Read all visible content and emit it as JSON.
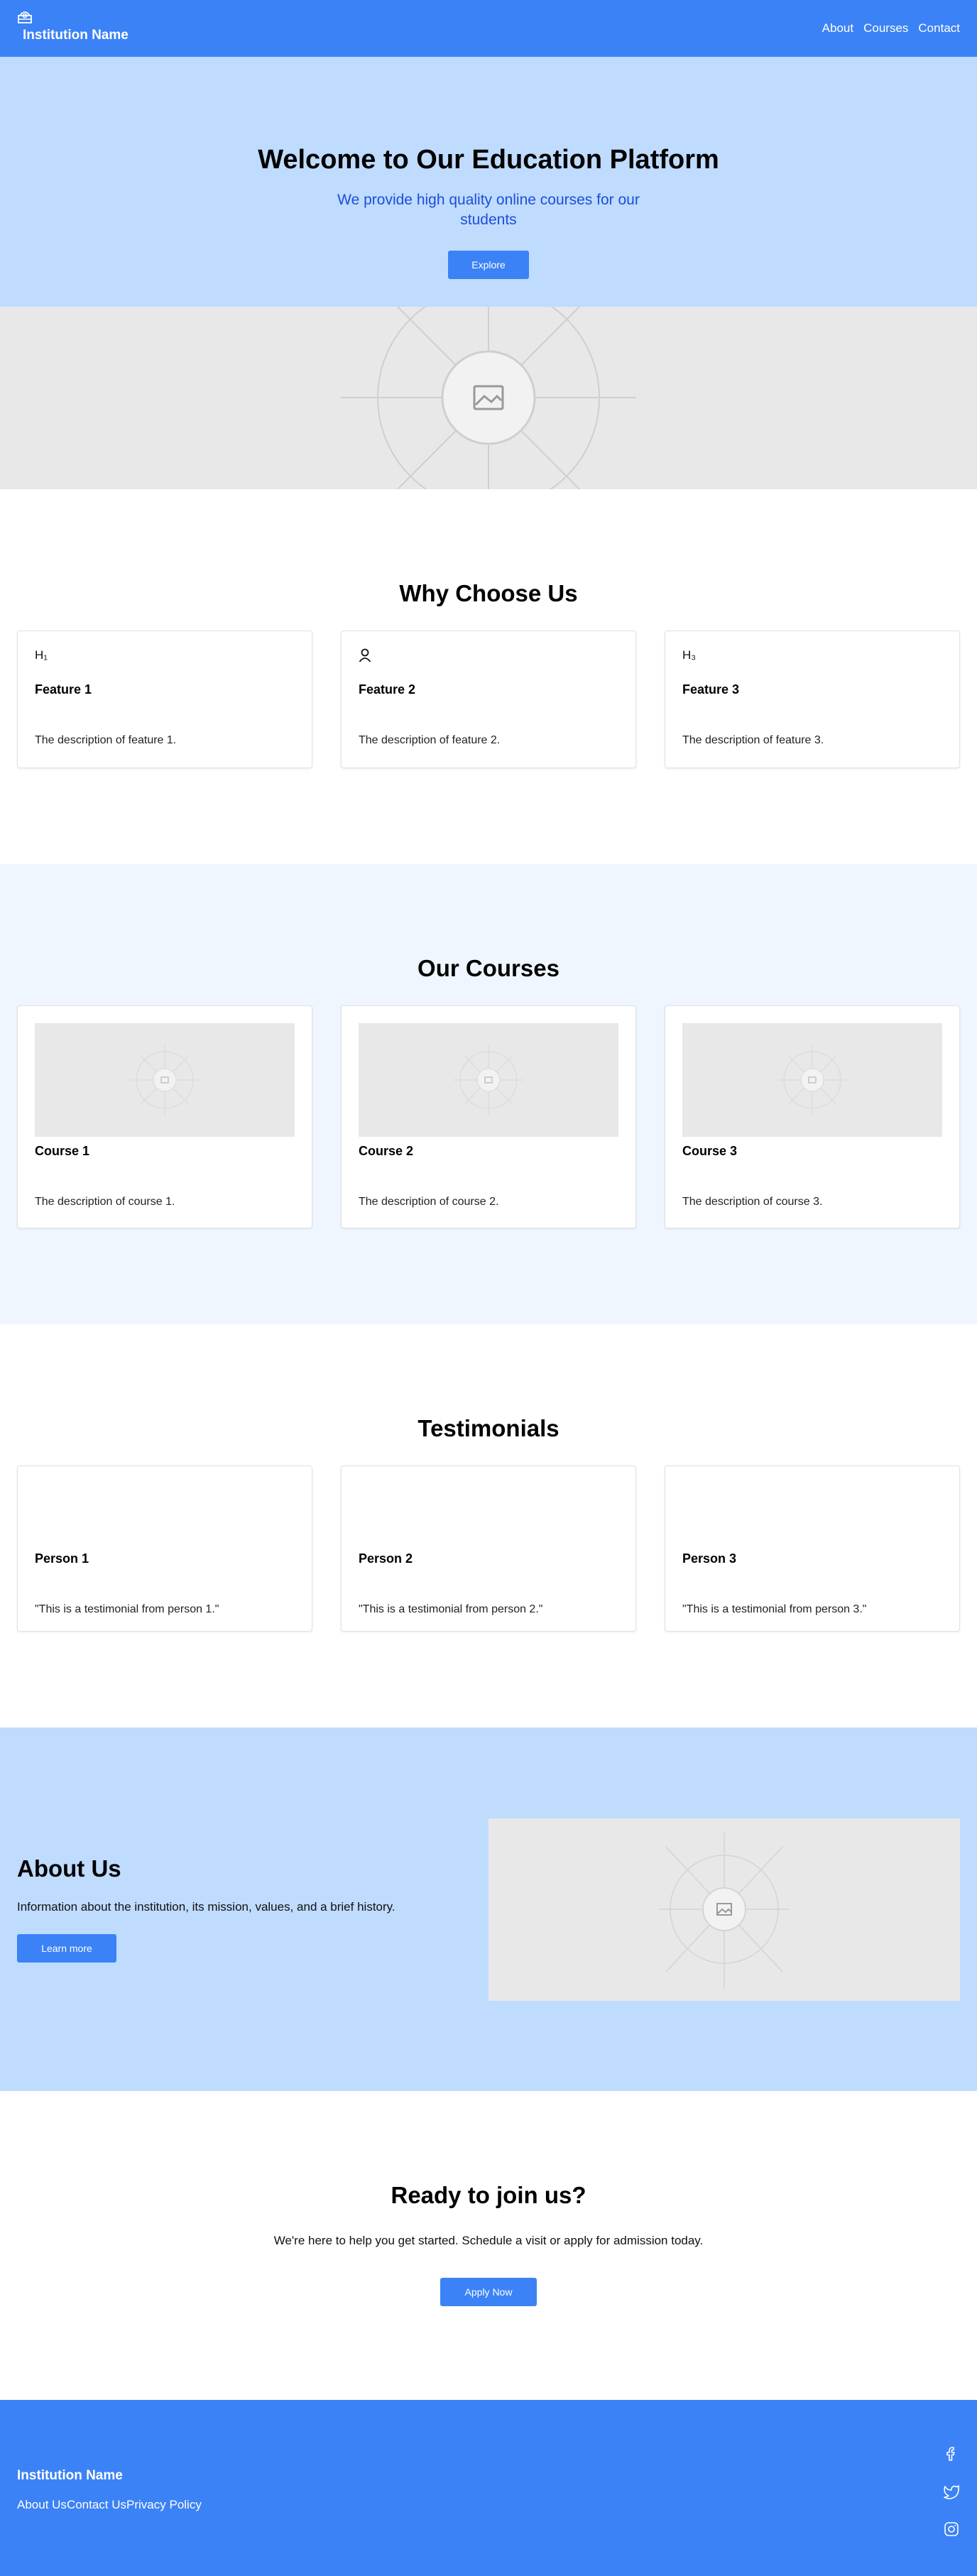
{
  "header": {
    "brand_name": "Institution Name",
    "nav": [
      "About",
      "Courses",
      "Contact"
    ]
  },
  "hero": {
    "title": "Welcome to Our Education Platform",
    "subtitle": "We provide high quality online courses for our students",
    "button_label": "Explore"
  },
  "features": {
    "title": "Why Choose Us",
    "items": [
      {
        "icon_label": "H₁",
        "icon": "heading-1-icon",
        "title": "Feature 1",
        "description": "The description of feature 1."
      },
      {
        "icon_label": "",
        "icon": "user-icon",
        "title": "Feature 2",
        "description": "The description of feature 2."
      },
      {
        "icon_label": "H₃",
        "icon": "heading-3-icon",
        "title": "Feature 3",
        "description": "The description of feature 3."
      }
    ]
  },
  "courses": {
    "title": "Our Courses",
    "items": [
      {
        "title": "Course 1",
        "description": "The description of course 1."
      },
      {
        "title": "Course 2",
        "description": "The description of course 2."
      },
      {
        "title": "Course 3",
        "description": "The description of course 3."
      }
    ]
  },
  "testimonials": {
    "title": "Testimonials",
    "items": [
      {
        "name": "Person 1",
        "quote": "\"This is a testimonial from person 1.\""
      },
      {
        "name": "Person 2",
        "quote": "\"This is a testimonial from person 2.\""
      },
      {
        "name": "Person 3",
        "quote": "\"This is a testimonial from person 3.\""
      }
    ]
  },
  "about": {
    "title": "About Us",
    "text": "Information about the institution, its mission, values, and a brief history.",
    "button_label": "Learn more"
  },
  "cta": {
    "title": "Ready to join us?",
    "text": "We're here to help you get started. Schedule a visit or apply for admission today.",
    "button_label": "Apply Now"
  },
  "footer": {
    "brand_name": "Institution Name",
    "links": [
      "About Us",
      "Contact Us",
      "Privacy Policy"
    ],
    "socials": [
      "facebook-icon",
      "twitter-icon",
      "instagram-icon"
    ]
  },
  "colors": {
    "primary": "#3b82f6",
    "light_blue": "#bfdbfe",
    "pale_blue": "#eff6ff",
    "subtitle_blue": "#1d4ed8",
    "placeholder_gray": "#e8e8e8"
  }
}
